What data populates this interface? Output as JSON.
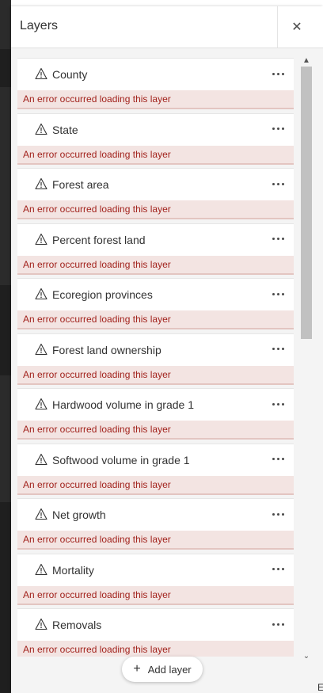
{
  "panel": {
    "title": "Layers",
    "close_icon": "close-icon",
    "add_layer_label": "Add layer"
  },
  "layers": [
    {
      "name": "County",
      "status": "An error occurred loading this layer"
    },
    {
      "name": "State",
      "status": "An error occurred loading this layer"
    },
    {
      "name": "Forest area",
      "status": "An error occurred loading this layer"
    },
    {
      "name": "Percent forest land",
      "status": "An error occurred loading this layer"
    },
    {
      "name": "Ecoregion provinces",
      "status": "An error occurred loading this layer"
    },
    {
      "name": "Forest land ownership",
      "status": "An error occurred loading this layer"
    },
    {
      "name": "Hardwood volume in grade 1",
      "status": "An error occurred loading this layer"
    },
    {
      "name": "Softwood volume in grade 1",
      "status": "An error occurred loading this layer"
    },
    {
      "name": "Net growth",
      "status": "An error occurred loading this layer"
    },
    {
      "name": "Mortality",
      "status": "An error occurred loading this layer"
    },
    {
      "name": "Removals",
      "status": "An error occurred loading this layer"
    }
  ],
  "corner_text": "E",
  "colors": {
    "error_text": "#a2231d",
    "error_bg": "#f3e4e2",
    "panel_bg": "#f4f4f4"
  }
}
